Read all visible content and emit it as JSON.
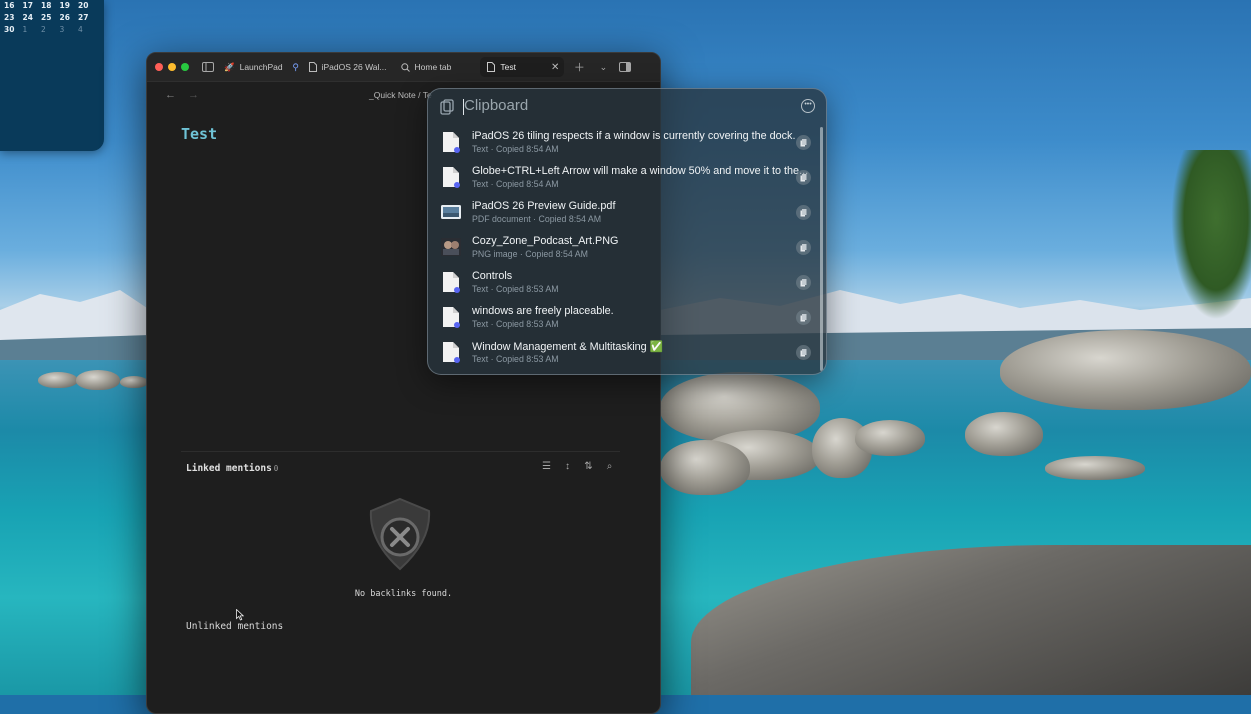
{
  "calendar": {
    "rows": [
      [
        "16",
        "17",
        "18",
        "19",
        "20"
      ],
      [
        "23",
        "24",
        "25",
        "26",
        "27"
      ],
      [
        "30",
        "1",
        "2",
        "3",
        "4"
      ]
    ]
  },
  "obsidian": {
    "tabs": [
      {
        "label": "LaunchPad",
        "icon": "rocket-icon"
      },
      {
        "label": "iPadOS 26 Wal...",
        "icon": "file-icon"
      },
      {
        "label": "Home tab",
        "icon": "search-icon"
      },
      {
        "label": "Test",
        "icon": "file-icon",
        "active": true
      }
    ],
    "breadcrumb": "_Quick Note / Te",
    "note_title": "Test",
    "linked_mentions": {
      "label": "Linked mentions",
      "count": "0"
    },
    "no_backlinks": "No backlinks found.",
    "unlinked_mentions": "Unlinked mentions"
  },
  "clipboard": {
    "placeholder": "Clipboard",
    "items": [
      {
        "title": "iPadOS 26 tiling respects if a window is currently covering the dock.",
        "kind": "Text",
        "time": "Copied 8:54 AM",
        "icon": "text-file-icon"
      },
      {
        "title": "Globe+CTRL+Left Arrow will make a window 50% and move it to the...",
        "kind": "Text",
        "time": "Copied 8:54 AM",
        "icon": "text-file-icon"
      },
      {
        "title": "iPadOS 26 Preview Guide.pdf",
        "kind": "PDF document",
        "time": "Copied 8:54 AM",
        "icon": "pdf-thumbnail-icon"
      },
      {
        "title": "Cozy_Zone_Podcast_Art.PNG",
        "kind": "PNG image",
        "time": "Copied 8:54 AM",
        "icon": "image-thumbnail-icon"
      },
      {
        "title": "Controls",
        "kind": "Text",
        "time": "Copied 8:53 AM",
        "icon": "text-file-icon"
      },
      {
        "title": "windows are freely placeable.",
        "kind": "Text",
        "time": "Copied 8:53 AM",
        "icon": "text-file-icon"
      },
      {
        "title": "Window Management & Multitasking ✅",
        "kind": "Text",
        "time": "Copied 8:53 AM",
        "icon": "text-file-icon"
      }
    ],
    "subtitle_separator": " · "
  },
  "colors": {
    "accent_title": "#6fc3d6",
    "traffic_red": "#ff5f57",
    "traffic_yellow": "#febc2e",
    "traffic_green": "#28c840"
  }
}
